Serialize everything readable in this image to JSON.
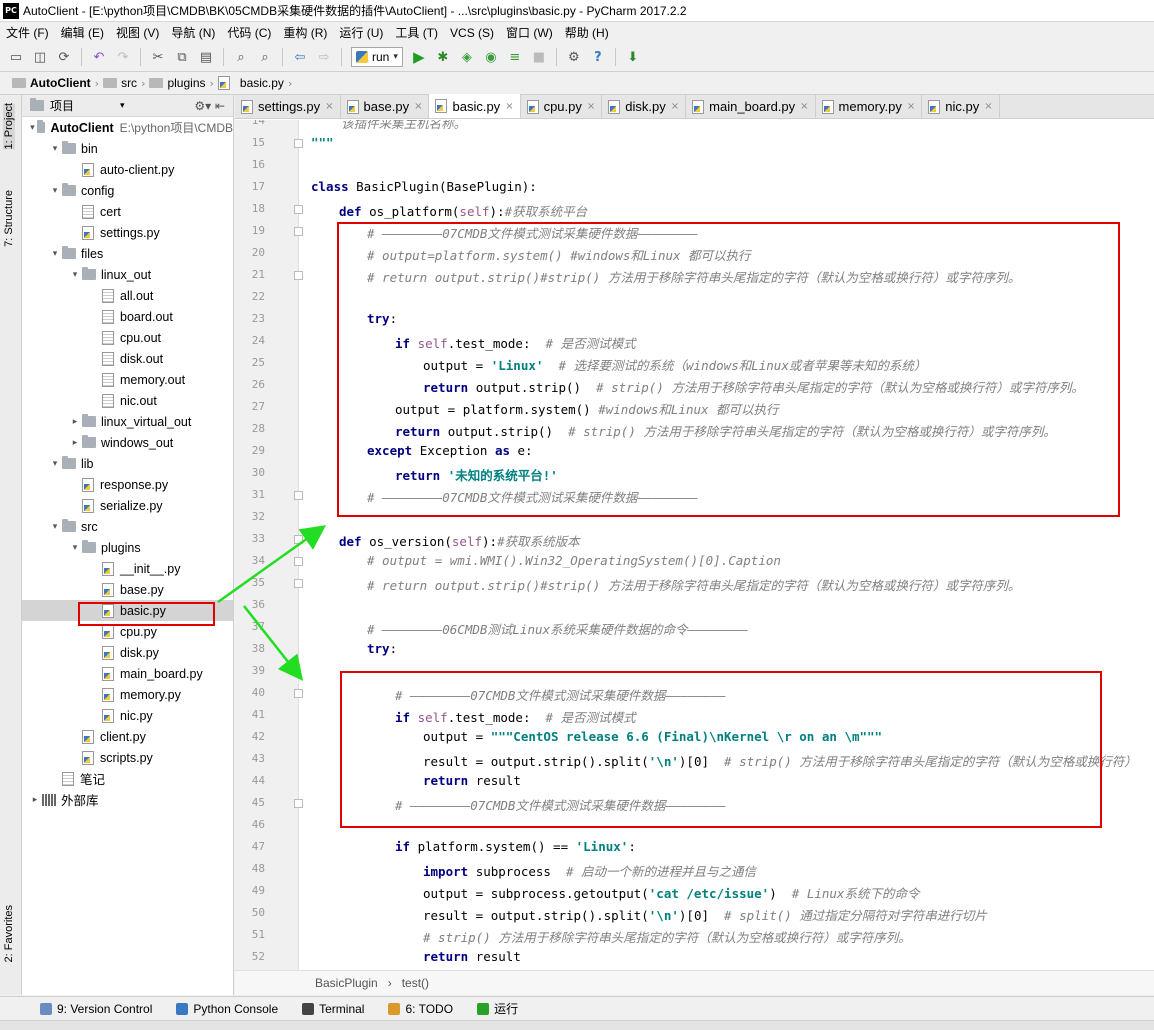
{
  "window": {
    "title": "AutoClient - [E:\\python项目\\CMDB\\BK\\05CMDB采集硬件数据的插件\\AutoClient] - ...\\src\\plugins\\basic.py - PyCharm 2017.2.2",
    "logo_text": "PC"
  },
  "menu": [
    "文件 (F)",
    "编辑 (E)",
    "视图 (V)",
    "导航 (N)",
    "代码 (C)",
    "重构 (R)",
    "运行 (U)",
    "工具 (T)",
    "VCS (S)",
    "窗口 (W)",
    "帮助 (H)"
  ],
  "toolbar": {
    "run_config": "run"
  },
  "navbar": {
    "items": [
      "AutoClient",
      "src",
      "plugins",
      "basic.py"
    ]
  },
  "left_strip": {
    "project": "1: Project",
    "structure": "7: Structure",
    "favorites": "2: Favorites"
  },
  "project_panel": {
    "header": "项目",
    "root_path": "E:\\python项目\\CMDB",
    "tree": [
      {
        "depth": 0,
        "type": "folder",
        "label": "AutoClient",
        "open": true,
        "bold": true
      },
      {
        "depth": 1,
        "type": "folder",
        "label": "bin",
        "open": true
      },
      {
        "depth": 2,
        "type": "py",
        "label": "auto-client.py"
      },
      {
        "depth": 1,
        "type": "folder",
        "label": "config",
        "open": true
      },
      {
        "depth": 2,
        "type": "file",
        "label": "cert"
      },
      {
        "depth": 2,
        "type": "py",
        "label": "settings.py"
      },
      {
        "depth": 1,
        "type": "folder",
        "label": "files",
        "open": true
      },
      {
        "depth": 2,
        "type": "folder",
        "label": "linux_out",
        "open": true
      },
      {
        "depth": 3,
        "type": "file",
        "label": "all.out"
      },
      {
        "depth": 3,
        "type": "file",
        "label": "board.out"
      },
      {
        "depth": 3,
        "type": "file",
        "label": "cpu.out"
      },
      {
        "depth": 3,
        "type": "file",
        "label": "disk.out"
      },
      {
        "depth": 3,
        "type": "file",
        "label": "memory.out"
      },
      {
        "depth": 3,
        "type": "file",
        "label": "nic.out"
      },
      {
        "depth": 2,
        "type": "folder",
        "label": "linux_virtual_out",
        "open": false
      },
      {
        "depth": 2,
        "type": "folder",
        "label": "windows_out",
        "open": false
      },
      {
        "depth": 1,
        "type": "folder",
        "label": "lib",
        "open": true
      },
      {
        "depth": 2,
        "type": "py",
        "label": "response.py"
      },
      {
        "depth": 2,
        "type": "py",
        "label": "serialize.py"
      },
      {
        "depth": 1,
        "type": "folder",
        "label": "src",
        "open": true
      },
      {
        "depth": 2,
        "type": "folder",
        "label": "plugins",
        "open": true
      },
      {
        "depth": 3,
        "type": "py",
        "label": "__init__.py"
      },
      {
        "depth": 3,
        "type": "py",
        "label": "base.py"
      },
      {
        "depth": 3,
        "type": "py",
        "label": "basic.py",
        "selected": true
      },
      {
        "depth": 3,
        "type": "py",
        "label": "cpu.py"
      },
      {
        "depth": 3,
        "type": "py",
        "label": "disk.py"
      },
      {
        "depth": 3,
        "type": "py",
        "label": "main_board.py"
      },
      {
        "depth": 3,
        "type": "py",
        "label": "memory.py"
      },
      {
        "depth": 3,
        "type": "py",
        "label": "nic.py"
      },
      {
        "depth": 2,
        "type": "py",
        "label": "client.py"
      },
      {
        "depth": 2,
        "type": "py",
        "label": "scripts.py"
      },
      {
        "depth": 1,
        "type": "file",
        "label": "笔记"
      },
      {
        "depth": 0,
        "type": "lib",
        "label": "外部库",
        "open": false
      }
    ]
  },
  "tabs": [
    {
      "label": "settings.py"
    },
    {
      "label": "base.py"
    },
    {
      "label": "basic.py",
      "active": true
    },
    {
      "label": "cpu.py"
    },
    {
      "label": "disk.py"
    },
    {
      "label": "main_board.py"
    },
    {
      "label": "memory.py"
    },
    {
      "label": "nic.py"
    }
  ],
  "code_lines": [
    {
      "n": "14",
      "i": 0,
      "t": [
        [
          "cm",
          "    该插件采集主机名称。"
        ]
      ]
    },
    {
      "n": "15",
      "i": 0,
      "t": [
        [
          "st",
          "\"\"\""
        ]
      ]
    },
    {
      "n": "16",
      "i": 0,
      "t": []
    },
    {
      "n": "17",
      "i": 0,
      "t": [
        [
          "kw",
          "class "
        ],
        [
          "",
          "BasicPlugin(BasePlugin):"
        ]
      ]
    },
    {
      "n": "18",
      "i": 1,
      "t": [
        [
          "kw",
          "def "
        ],
        [
          "",
          "os_platform("
        ],
        [
          "sf",
          "self"
        ],
        [
          "",
          "):"
        ],
        [
          "cm",
          "#获取系统平台"
        ]
      ]
    },
    {
      "n": "19",
      "i": 2,
      "t": [
        [
          "cm",
          "# ————————07CMDB文件模式测试采集硬件数据————————"
        ]
      ]
    },
    {
      "n": "20",
      "i": 2,
      "t": [
        [
          "cm",
          "# output=platform.system() #windows和Linux 都可以执行"
        ]
      ]
    },
    {
      "n": "21",
      "i": 2,
      "t": [
        [
          "cm",
          "# return output.strip()#strip() 方法用于移除字符串头尾指定的字符（默认为空格或换行符）或字符序列。"
        ]
      ]
    },
    {
      "n": "22",
      "i": 0,
      "t": []
    },
    {
      "n": "23",
      "i": 2,
      "t": [
        [
          "kw",
          "try"
        ],
        [
          "",
          ":"
        ]
      ]
    },
    {
      "n": "24",
      "i": 3,
      "t": [
        [
          "kw",
          "if "
        ],
        [
          "sf",
          "self"
        ],
        [
          "",
          ".test_mode:  "
        ],
        [
          "cm",
          "# 是否测试模式"
        ]
      ]
    },
    {
      "n": "25",
      "i": 4,
      "t": [
        [
          "",
          "output = "
        ],
        [
          "st",
          "'Linux'"
        ],
        [
          "",
          "  "
        ],
        [
          "cm",
          "# 选择要测试的系统（windows和Linux或者苹果等未知的系统）"
        ]
      ]
    },
    {
      "n": "26",
      "i": 4,
      "t": [
        [
          "kw",
          "return "
        ],
        [
          "",
          "output.strip()  "
        ],
        [
          "cm",
          "# strip() 方法用于移除字符串头尾指定的字符（默认为空格或换行符）或字符序列。"
        ]
      ]
    },
    {
      "n": "27",
      "i": 3,
      "t": [
        [
          "",
          "output = platform.system() "
        ],
        [
          "cm",
          "#windows和Linux 都可以执行"
        ]
      ]
    },
    {
      "n": "28",
      "i": 3,
      "t": [
        [
          "kw",
          "return "
        ],
        [
          "",
          "output.strip()  "
        ],
        [
          "cm",
          "# strip() 方法用于移除字符串头尾指定的字符（默认为空格或换行符）或字符序列。"
        ]
      ]
    },
    {
      "n": "29",
      "i": 2,
      "t": [
        [
          "kw",
          "except "
        ],
        [
          "",
          "Exception "
        ],
        [
          "kw",
          "as "
        ],
        [
          "",
          "e:"
        ]
      ]
    },
    {
      "n": "30",
      "i": 3,
      "t": [
        [
          "kw",
          "return "
        ],
        [
          "st",
          "'未知的系统平台!'"
        ]
      ]
    },
    {
      "n": "31",
      "i": 2,
      "t": [
        [
          "cm",
          "# ————————07CMDB文件模式测试采集硬件数据————————"
        ]
      ]
    },
    {
      "n": "32",
      "i": 0,
      "t": []
    },
    {
      "n": "33",
      "i": 1,
      "t": [
        [
          "kw",
          "def "
        ],
        [
          "",
          "os_version("
        ],
        [
          "sf",
          "self"
        ],
        [
          "",
          "):"
        ],
        [
          "cm",
          "#获取系统版本"
        ]
      ]
    },
    {
      "n": "34",
      "i": 2,
      "t": [
        [
          "cm",
          "# output = wmi.WMI().Win32_OperatingSystem()[0].Caption"
        ]
      ]
    },
    {
      "n": "35",
      "i": 2,
      "t": [
        [
          "cm",
          "# return output.strip()#strip() 方法用于移除字符串头尾指定的字符（默认为空格或换行符）或字符序列。"
        ]
      ]
    },
    {
      "n": "36",
      "i": 0,
      "t": []
    },
    {
      "n": "37",
      "i": 2,
      "t": [
        [
          "cm",
          "# ————————06CMDB测试Linux系统采集硬件数据的命令————————"
        ]
      ]
    },
    {
      "n": "38",
      "i": 2,
      "t": [
        [
          "kw",
          "try"
        ],
        [
          "",
          ":"
        ]
      ]
    },
    {
      "n": "39",
      "i": 0,
      "t": []
    },
    {
      "n": "40",
      "i": 3,
      "t": [
        [
          "cm",
          "# ————————07CMDB文件模式测试采集硬件数据————————"
        ]
      ]
    },
    {
      "n": "41",
      "i": 3,
      "t": [
        [
          "kw",
          "if "
        ],
        [
          "sf",
          "self"
        ],
        [
          "",
          ".test_mode:  "
        ],
        [
          "cm",
          "# 是否测试模式"
        ]
      ]
    },
    {
      "n": "42",
      "i": 4,
      "t": [
        [
          "",
          "output = "
        ],
        [
          "st",
          "\"\"\"CentOS release 6.6 (Final)\\nKernel \\r on an \\m\"\"\""
        ]
      ]
    },
    {
      "n": "43",
      "i": 4,
      "t": [
        [
          "",
          "result = output.strip().split("
        ],
        [
          "st",
          "'\\n'"
        ],
        [
          "",
          ")[0]  "
        ],
        [
          "cm",
          "# strip() 方法用于移除字符串头尾指定的字符（默认为空格或换行符）"
        ]
      ]
    },
    {
      "n": "44",
      "i": 4,
      "t": [
        [
          "kw",
          "return "
        ],
        [
          "",
          "result"
        ]
      ]
    },
    {
      "n": "45",
      "i": 3,
      "t": [
        [
          "cm",
          "# ————————07CMDB文件模式测试采集硬件数据————————"
        ]
      ]
    },
    {
      "n": "46",
      "i": 0,
      "t": []
    },
    {
      "n": "47",
      "i": 3,
      "t": [
        [
          "kw",
          "if "
        ],
        [
          "",
          "platform.system() == "
        ],
        [
          "st",
          "'Linux'"
        ],
        [
          "",
          ":"
        ]
      ]
    },
    {
      "n": "48",
      "i": 4,
      "t": [
        [
          "kw",
          "import "
        ],
        [
          "",
          "subprocess  "
        ],
        [
          "cm",
          "# 启动一个新的进程并且与之通信"
        ]
      ]
    },
    {
      "n": "49",
      "i": 4,
      "t": [
        [
          "",
          "output = subprocess.getoutput("
        ],
        [
          "st",
          "'cat /etc/issue'"
        ],
        [
          "",
          ")  "
        ],
        [
          "cm",
          "# Linux系统下的命令"
        ]
      ]
    },
    {
      "n": "50",
      "i": 4,
      "t": [
        [
          "",
          "result = output.strip().split("
        ],
        [
          "st",
          "'\\n'"
        ],
        [
          "",
          ")[0]  "
        ],
        [
          "cm",
          "# split() 通过指定分隔符对字符串进行切片"
        ]
      ]
    },
    {
      "n": "51",
      "i": 4,
      "t": [
        [
          "cm",
          "# strip() 方法用于移除字符串头尾指定的字符（默认为空格或换行符）或字符序列。"
        ]
      ]
    },
    {
      "n": "52",
      "i": 4,
      "t": [
        [
          "kw",
          "return "
        ],
        [
          "",
          "result"
        ]
      ]
    }
  ],
  "editor_breadcrumb": [
    "BasicPlugin",
    "test()"
  ],
  "status_tabs": [
    {
      "label": "9: Version Control",
      "color": "#6a8cc0"
    },
    {
      "label": "Python Console",
      "color": "#3b78c2"
    },
    {
      "label": "Terminal",
      "color": "#444444"
    },
    {
      "label": "6: TODO",
      "color": "#d99a2b"
    },
    {
      "label": "运行",
      "color": "#2aa02a"
    }
  ],
  "colors": {
    "annotation_box": "#e00000",
    "annotation_arrow": "#22dd22"
  }
}
